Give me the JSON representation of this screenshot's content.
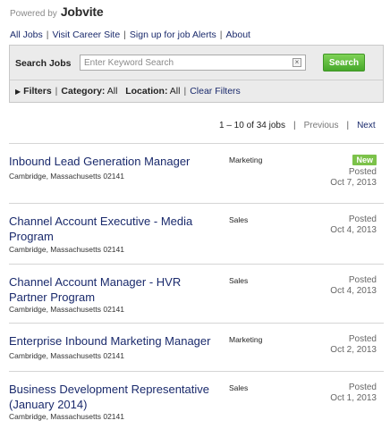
{
  "brand": {
    "powered_by": "Powered by",
    "logo": "Jobvite"
  },
  "nav": {
    "all_jobs": "All Jobs",
    "visit_site": "Visit Career Site",
    "alerts": "Sign up for job Alerts",
    "about": "About",
    "separator": "|"
  },
  "search": {
    "label": "Search Jobs",
    "placeholder": "Enter Keyword Search",
    "value": "",
    "button": "Search",
    "clear_icon": "clear-x-icon"
  },
  "filters": {
    "toggle": "Filters",
    "category_label": "Category:",
    "category_value": "All",
    "location_label": "Location:",
    "location_value": "All",
    "clear": "Clear Filters"
  },
  "pagination": {
    "count": "1 – 10 of 34 jobs",
    "previous": "Previous",
    "next": "Next"
  },
  "jobs": [
    {
      "title": "Inbound Lead Generation Manager",
      "location": "Cambridge, Massachusetts 02141",
      "category": "Marketing",
      "badge": "New",
      "posted": "Posted",
      "date": "Oct 7, 2013"
    },
    {
      "title": "Channel Account Executive - Media Program",
      "location": "Cambridge, Massachusetts 02141",
      "category": "Sales",
      "badge": "",
      "posted": "Posted",
      "date": "Oct 4, 2013"
    },
    {
      "title": "Channel Account Manager - HVR Partner Program",
      "location": "Cambridge, Massachusetts 02141",
      "category": "Sales",
      "badge": "",
      "posted": "Posted",
      "date": "Oct 4, 2013"
    },
    {
      "title": "Enterprise Inbound Marketing Manager",
      "location": "Cambridge, Massachusetts 02141",
      "category": "Marketing",
      "badge": "",
      "posted": "Posted",
      "date": "Oct 2, 2013"
    },
    {
      "title": "Business Development Representative (January 2014)",
      "location": "Cambridge, Massachusetts 02141",
      "category": "Sales",
      "badge": "",
      "posted": "Posted",
      "date": "Oct 1, 2013"
    }
  ],
  "colors": {
    "link": "#1a2a6c",
    "accent_green": "#5cb83a",
    "badge_green": "#7cc24a"
  }
}
